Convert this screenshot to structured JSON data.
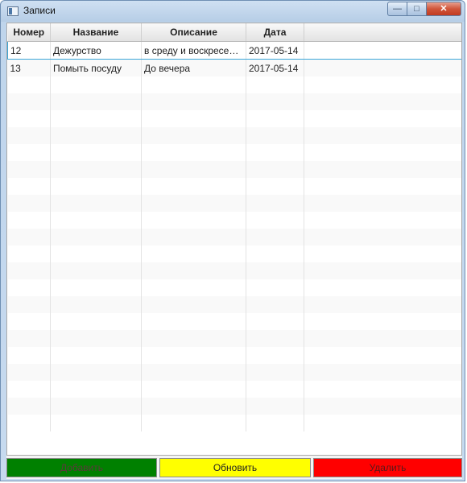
{
  "window": {
    "title": "Записи"
  },
  "table": {
    "columns": [
      "Номер",
      "Название",
      "Описание",
      "Дата",
      ""
    ],
    "rows": [
      [
        "12",
        "Дежурство",
        "в среду и воскресенье",
        "2017-05-14",
        ""
      ],
      [
        "13",
        "Помыть посуду",
        "До вечера",
        "2017-05-14",
        ""
      ]
    ],
    "empty_row_count": 21
  },
  "buttons": {
    "add": {
      "label": "Добавить",
      "color": "#008000"
    },
    "refresh": {
      "label": "Обновить",
      "color": "#ffff00"
    },
    "delete": {
      "label": "Удалить",
      "color": "#ff0000"
    }
  }
}
